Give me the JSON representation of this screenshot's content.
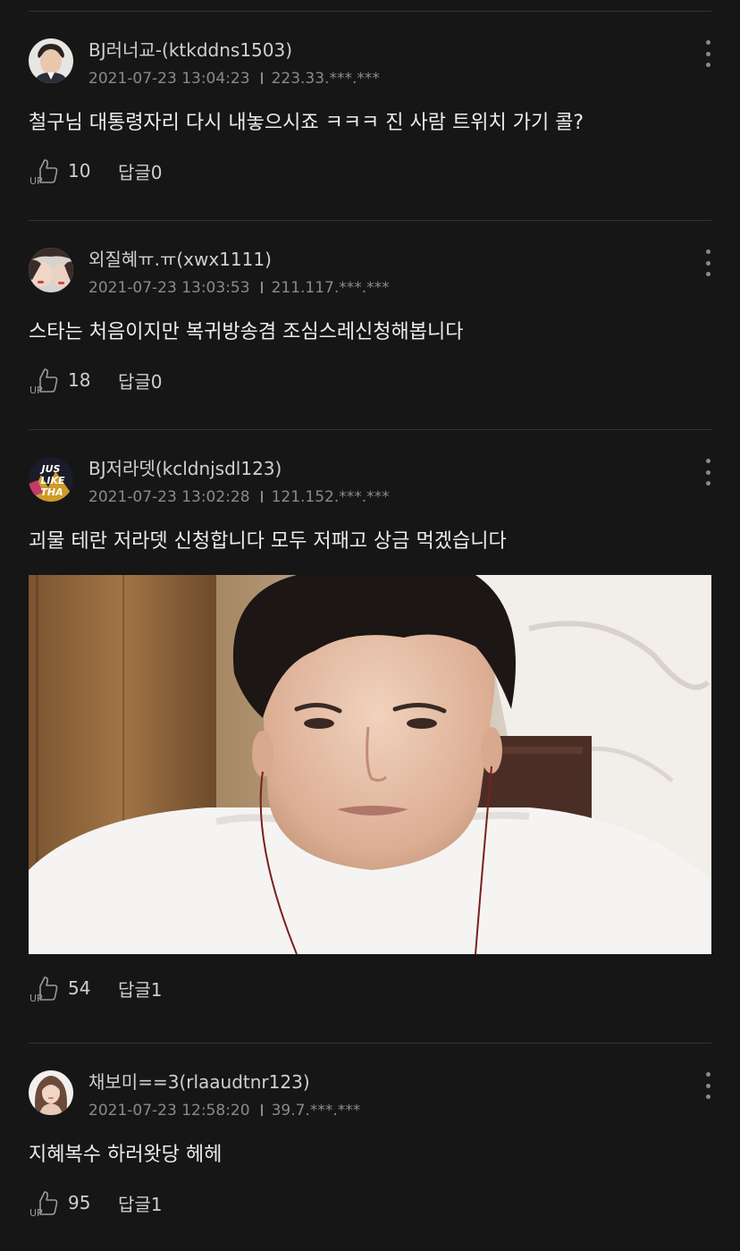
{
  "comments": [
    {
      "author": "BJ러너교-(ktkddns1503)",
      "date": "2021-07-23 13:04:23",
      "ip": "223.33.***.***",
      "text": "철구님 대통령자리 다시 내놓으시죠 ㅋㅋㅋ  진 사람 트위치 가기 콜?",
      "likes": "10",
      "replies": "답글0"
    },
    {
      "author": "외질혜ㅠ.ㅠ(xwx1111)",
      "date": "2021-07-23 13:03:53",
      "ip": "211.117.***.***",
      "text": "스타는 처음이지만 복귀방송겸 조심스레신청해봅니다",
      "likes": "18",
      "replies": "답글0"
    },
    {
      "author": "BJ저라뎃(kcldnjsdl123)",
      "date": "2021-07-23 13:02:28",
      "ip": "121.152.***.***",
      "text": "괴물 테란 저라뎃 신청합니다 모두 저패고 상금 먹겠습니다",
      "avatar_text": [
        "JUS",
        "LIKE",
        "THA"
      ],
      "likes": "54",
      "replies": "답글1"
    },
    {
      "author": "채보미==3(rlaaudtnr123)",
      "date": "2021-07-23 12:58:20",
      "ip": "39.7.***.***",
      "text": "지혜복수 하러왓당 헤헤",
      "likes": "95",
      "replies": "답글1"
    }
  ],
  "icons": {
    "like": "thumbs-up-icon",
    "more": "more-vertical-icon"
  },
  "colors": {
    "background": "#161616",
    "divider": "#333333",
    "meta": "#8a8a8a",
    "text": "#ececec"
  }
}
